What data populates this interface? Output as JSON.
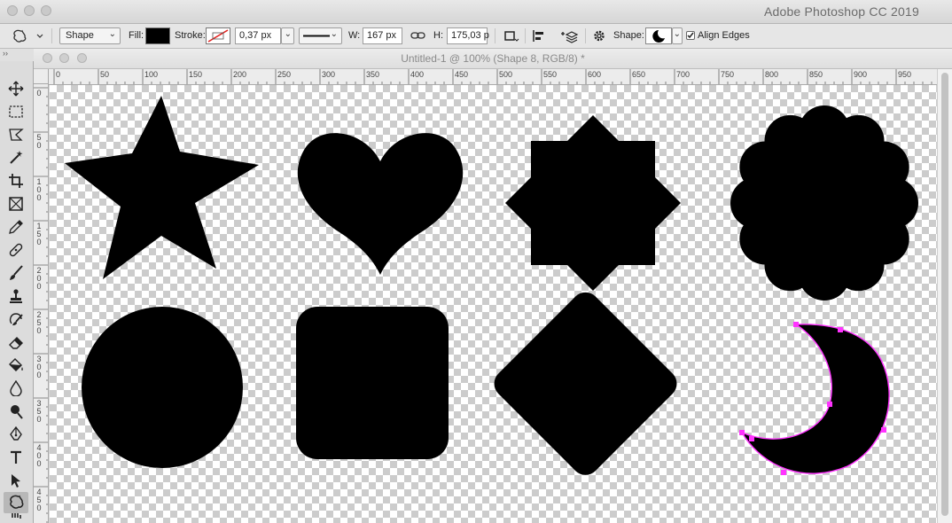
{
  "app": {
    "title": "Adobe Photoshop CC 2019"
  },
  "options_bar": {
    "mode": "Shape",
    "fill_label": "Fill:",
    "fill_color": "#000000",
    "stroke_label": "Stroke:",
    "stroke_width": "0,37 px",
    "w_label": "W:",
    "w_value": "167 px",
    "h_label": "H:",
    "h_value": "175,03 p",
    "shape_label": "Shape:",
    "align_edges_label": "Align Edges",
    "align_edges_checked": true
  },
  "document": {
    "title": "Untitled-1 @ 100% (Shape 8, RGB/8) *"
  },
  "ruler": {
    "top_labels": [
      "0",
      "50",
      "100",
      "150",
      "200",
      "250",
      "300",
      "350",
      "400",
      "450",
      "500",
      "550",
      "600",
      "650",
      "700",
      "750",
      "800",
      "850",
      "900",
      "950"
    ],
    "left_labels": [
      "0",
      "5\n0",
      "1\n0\n0",
      "1\n5\n0",
      "2\n0\n0",
      "2\n5\n0",
      "3\n0\n0",
      "3\n5\n0",
      "4\n0\n0",
      "4\n5\n0"
    ]
  },
  "colors": {
    "shape_fill": "#000000",
    "path_highlight": "#ff33ff"
  },
  "tools": [
    "move-icon",
    "marquee-icon",
    "lasso-icon",
    "magic-wand-icon",
    "crop-icon",
    "frame-icon",
    "eyedropper-icon",
    "healing-icon",
    "brush-icon",
    "stamp-icon",
    "history-brush-icon",
    "eraser-icon",
    "paint-bucket-icon",
    "blur-icon",
    "dodge-icon",
    "pen-icon",
    "type-icon",
    "path-selection-icon",
    "custom-shape-icon"
  ]
}
